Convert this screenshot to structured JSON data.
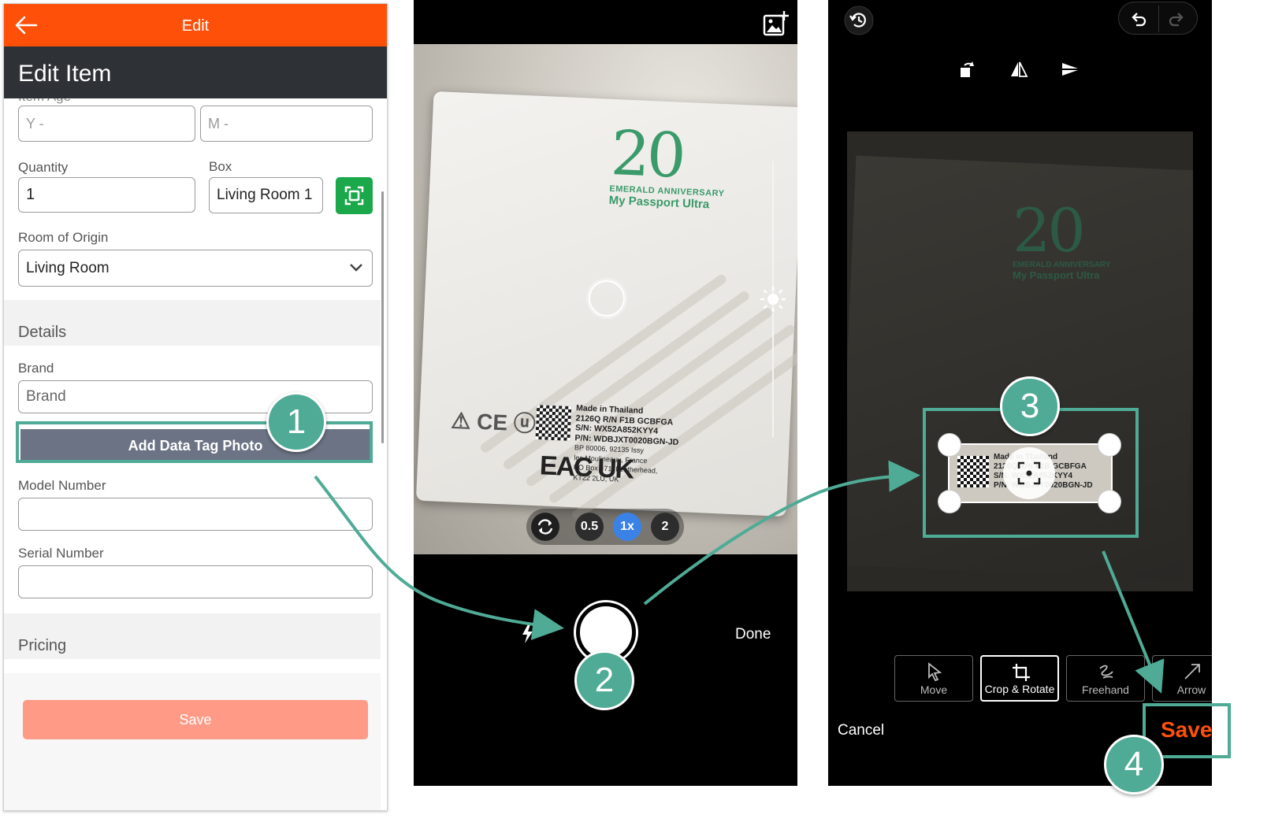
{
  "panel1": {
    "topbar_title": "Edit",
    "header_title": "Edit Item",
    "item_age_label": "Item Age",
    "years_placeholder": "Y -",
    "months_placeholder": "M -",
    "quantity_label": "Quantity",
    "quantity_value": "1",
    "box_label": "Box",
    "box_value": "Living Room 1",
    "room_label": "Room of Origin",
    "room_value": "Living Room",
    "details_section": "Details",
    "brand_label": "Brand",
    "brand_placeholder": "Brand",
    "add_tag_button": "Add Data Tag Photo",
    "model_label": "Model Number",
    "serial_label": "Serial Number",
    "pricing_section": "Pricing",
    "save_button": "Save"
  },
  "panel2": {
    "logo_number": "20",
    "logo_line1": "EMERALD ANNIVERSARY",
    "logo_line2": "My Passport Ultra",
    "tag_lines": [
      "Made in Thailand",
      "2126Q R/N F1B GCBFGA",
      "S/N:  WX52A852KYY4",
      "P/N:  WDBJXT0020BGN-JD",
      "BP 80006, 92135 Issy",
      "les Moulineaux, France",
      "PO Box 471, Leatherhead,",
      "KT22 2LU, UK"
    ],
    "zoom_options": [
      "0.5",
      "1x",
      "2"
    ],
    "zoom_selected": "1x",
    "done_label": "Done"
  },
  "panel3": {
    "tools": [
      "Move",
      "Crop & Rotate",
      "Freehand",
      "Arrow"
    ],
    "active_tool": "Crop & Rotate",
    "cancel_label": "Cancel",
    "save_label": "Save"
  },
  "annotations": {
    "steps": [
      "1",
      "2",
      "3",
      "4"
    ],
    "color": "#4fab96"
  },
  "colors": {
    "brand_orange": "#ff5009",
    "header_dark": "#2e3136",
    "scan_green": "#1aa84a",
    "tag_button": "#6b7384",
    "save_disabled": "#ff9a86",
    "zoom_active": "#3b82e6"
  }
}
